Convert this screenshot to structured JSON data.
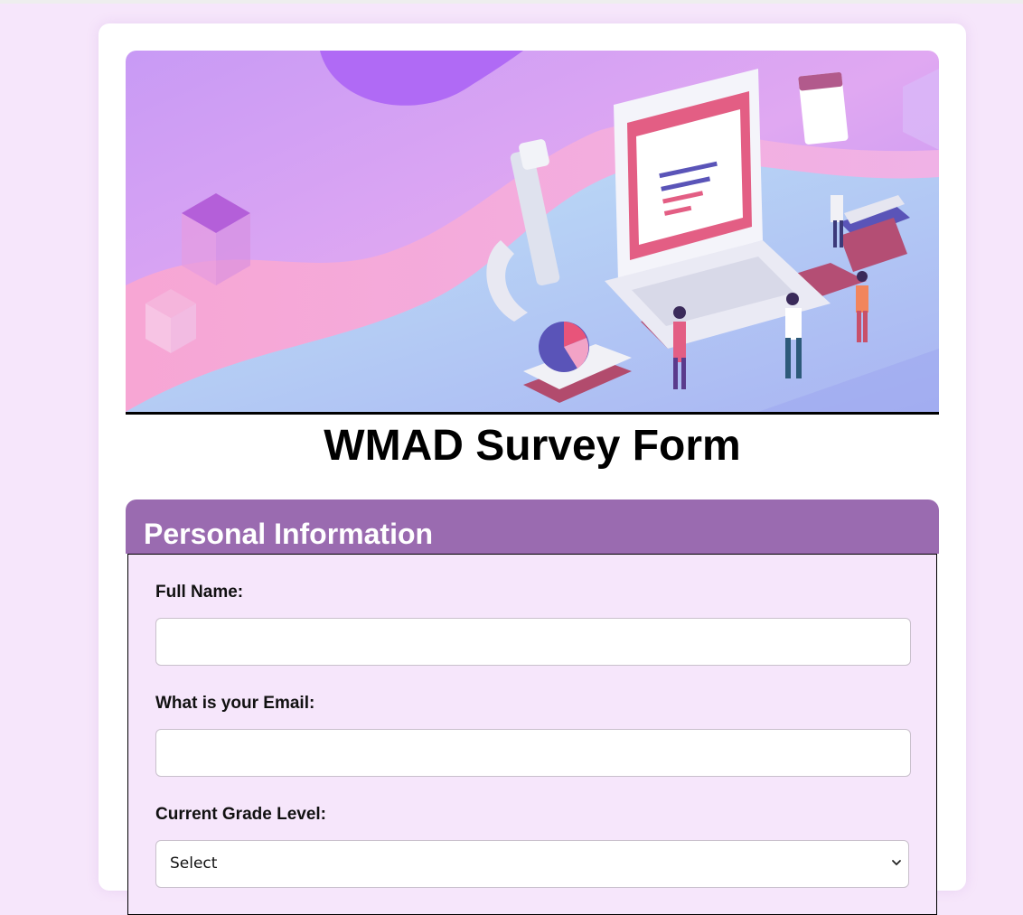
{
  "page": {
    "title": "WMAD Survey Form"
  },
  "personal_section": {
    "heading": "Personal Information",
    "fields": {
      "full_name": {
        "label": "Full Name:",
        "value": "",
        "placeholder": ""
      },
      "email": {
        "label": "What is your Email:",
        "value": "",
        "placeholder": ""
      },
      "grade_level": {
        "label": "Current Grade Level:",
        "selected": "Select"
      }
    }
  },
  "colors": {
    "page_background": "#f6e6fb",
    "section_header": "#9a6bb0",
    "card": "#ffffff"
  },
  "icons": {
    "select_chevron": "chevron-down-icon"
  }
}
